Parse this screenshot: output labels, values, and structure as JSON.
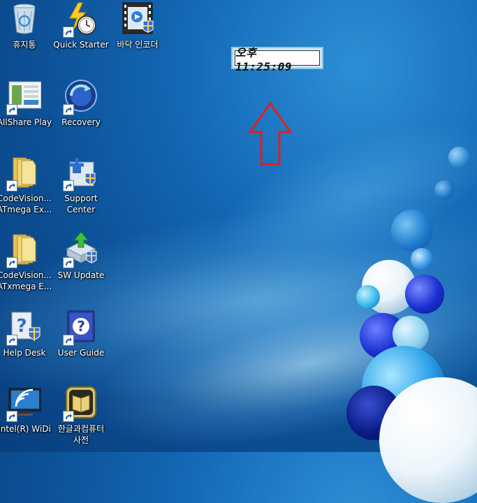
{
  "desktop": {
    "icons": [
      {
        "label": "휴지통",
        "icon": "recycle-bin-icon"
      },
      {
        "label": "Quick Starter",
        "icon": "stopwatch-icon"
      },
      {
        "label": "바닥 인코더",
        "icon": "video-encoder-icon"
      },
      {
        "label": "AllShare Play",
        "icon": "allshare-play-icon"
      },
      {
        "label": "Recovery",
        "icon": "recovery-icon"
      },
      {
        "label": "CodeVision...",
        "label2": "ATmega Ex...",
        "icon": "folder-icon"
      },
      {
        "label": "Support",
        "label2": "Center",
        "icon": "support-center-icon"
      },
      {
        "label": "CodeVision...",
        "label2": "ATxmega E...",
        "icon": "folder-icon"
      },
      {
        "label": "SW Update",
        "icon": "sw-update-icon"
      },
      {
        "label": "Help Desk",
        "icon": "help-desk-icon"
      },
      {
        "label": "User Guide",
        "icon": "user-guide-icon"
      },
      {
        "label": "Intel(R) WiDi",
        "icon": "widi-icon"
      },
      {
        "label": "한글과컴퓨터",
        "label2": "사전",
        "icon": "hancom-dictionary-icon"
      }
    ]
  },
  "clock_widget": {
    "time": "오후 11:25:09"
  },
  "colors": {
    "arrow": "#e01f1f",
    "desktop_bg": "#1468b5"
  }
}
